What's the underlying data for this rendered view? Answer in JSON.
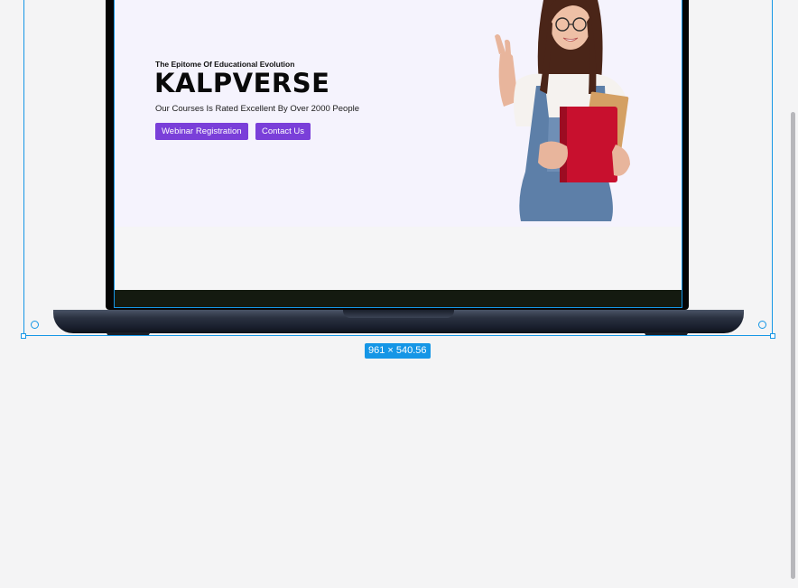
{
  "website": {
    "eyebrow": "The Epitome Of Educational Evolution",
    "brand": "KALPVERSE",
    "tagline": "Our Courses Is Rated Excellent By Over 2000 People",
    "buttons": {
      "webinar": "Webinar Registration",
      "contact": "Contact Us"
    },
    "accent_color": "#7a3fd9",
    "hero_image": "student-holding-books-illustration"
  },
  "editor": {
    "selection_size": "961 × 540.56",
    "selection_color": "#1596e6"
  }
}
